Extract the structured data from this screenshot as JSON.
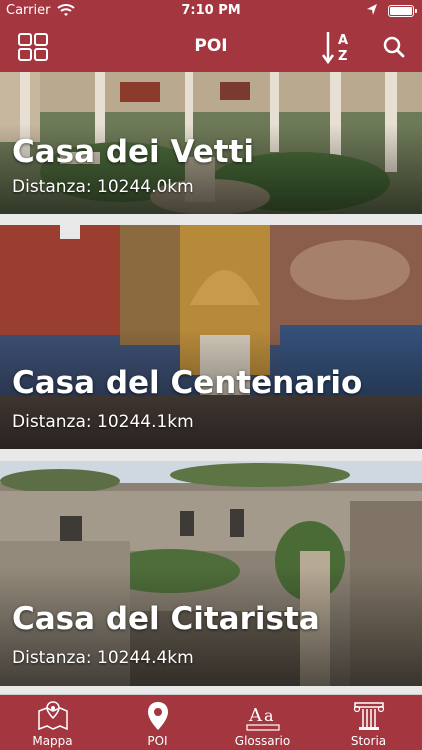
{
  "status_bar": {
    "carrier": "Carrier",
    "time": "7:10 PM"
  },
  "navbar": {
    "title": "POI",
    "sort_icon_text": "A Z"
  },
  "poi_list": [
    {
      "name": "Casa dei Vetti",
      "distance": "Distanza: 10244.0km"
    },
    {
      "name": "Casa del Centenario",
      "distance": "Distanza: 10244.1km"
    },
    {
      "name": "Casa del Citarista",
      "distance": "Distanza: 10244.4km"
    }
  ],
  "tab_bar": {
    "tabs": [
      {
        "label": "Mappa",
        "icon": "map-icon"
      },
      {
        "label": "POI",
        "icon": "location-pin-icon"
      },
      {
        "label": "Glossario",
        "icon": "glossary-icon"
      },
      {
        "label": "Storia",
        "icon": "column-icon"
      }
    ]
  },
  "colors": {
    "brand": "#a3363f",
    "background": "#e9e9e9"
  }
}
